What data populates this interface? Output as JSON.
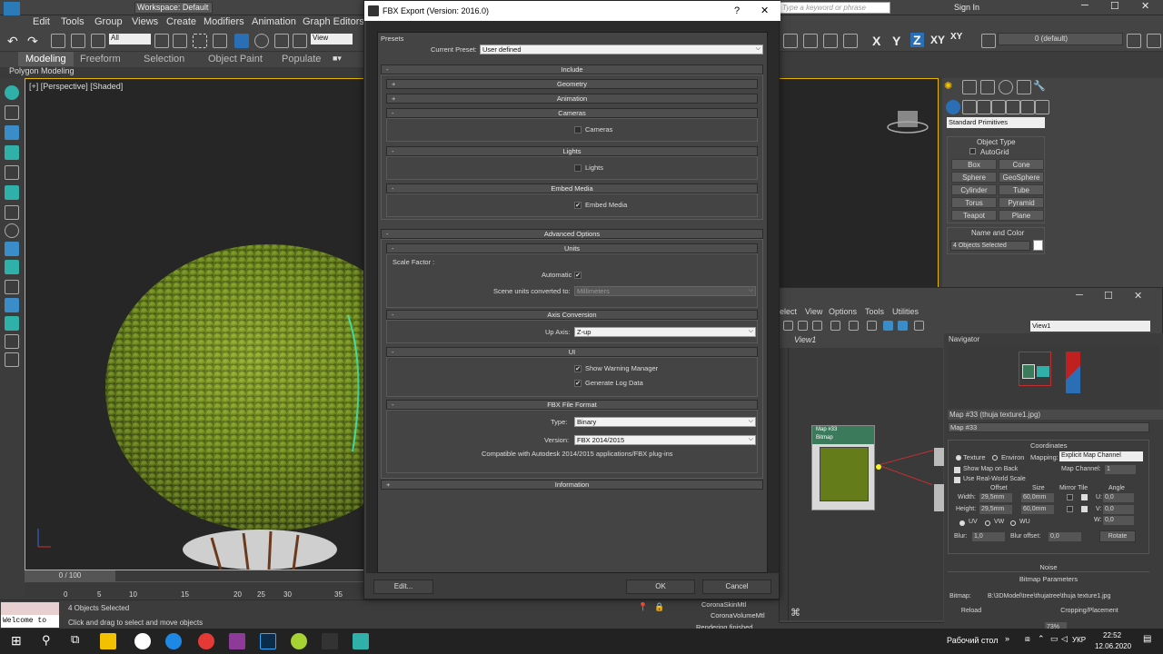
{
  "max": {
    "workspace": "Workspace: Default",
    "search_placeholder": "Type a keyword or phrase",
    "sign_in": "Sign In",
    "menu": [
      "Edit",
      "Tools",
      "Group",
      "Views",
      "Create",
      "Modifiers",
      "Animation",
      "Graph Editors"
    ],
    "toolbar": {
      "filter": "All",
      "refcoord": "View",
      "axes": [
        "X",
        "Y",
        "Z",
        "XY",
        "XY"
      ],
      "selection_set": "0 (default)"
    },
    "ribbon_tabs": [
      "Modeling",
      "Freeform",
      "Selection",
      "Object Paint",
      "Populate"
    ],
    "sub_ribbon": "Polygon Modeling",
    "viewport_label": "[+] [Perspective] [Shaded]",
    "timeline": {
      "frame": "0 / 100",
      "ticks": [
        "0",
        "5",
        "10",
        "15",
        "20",
        "25",
        "30",
        "35"
      ]
    },
    "status": {
      "selected": "4 Objects Selected",
      "hint": "Click and drag to select and move objects",
      "listener": "Welcome to"
    }
  },
  "rightpanel": {
    "category": "Standard Primitives",
    "object_type_header": "Object Type",
    "autogrid": "AutoGrid",
    "primitives": [
      "Box",
      "Cone",
      "Sphere",
      "GeoSphere",
      "Cylinder",
      "Tube",
      "Torus",
      "Pyramid",
      "Teapot",
      "Plane"
    ],
    "name_color_header": "Name and Color",
    "name_value": "4 Objects Selected"
  },
  "slate": {
    "menu": [
      "elect",
      "View",
      "Options",
      "Tools",
      "Utilities"
    ],
    "view_combo": "View1",
    "view_tab": "View1",
    "navigator": "Navigator",
    "node_title": "Map #33",
    "node_sub": "Bitmap",
    "mat_list": [
      "CoronaSkinMtl",
      "CoronaVolumeMtl"
    ],
    "rendering": "Rendering finished",
    "map_header": "Map #33  (thuja texture1.jpg)",
    "map_name": "Map #33",
    "coordinates_header": "Coordinates",
    "texture": "Texture",
    "environ": "Environ",
    "mapping_label": "Mapping:",
    "mapping_value": "Explicit Map Channel",
    "show_map_back": "Show Map on Back",
    "map_channel_label": "Map Channel:",
    "map_channel_value": "1",
    "use_real_world": "Use Real-World Scale",
    "col_offset": "Offset",
    "col_size": "Size",
    "col_mirror": "Mirror Tile",
    "col_angle": "Angle",
    "width_label": "Width:",
    "width_offset": "29,5mm",
    "width_size": "60,0mm",
    "height_label": "Height:",
    "height_offset": "29,5mm",
    "height_size": "60,0mm",
    "u_label": "U:",
    "u_angle": "0,0",
    "v_label": "V:",
    "v_angle": "0,0",
    "w_label": "W:",
    "w_angle": "0,0",
    "uv": "UV",
    "vw": "VW",
    "wu": "WU",
    "blur_label": "Blur:",
    "blur_value": "1,0",
    "blur_offset_label": "Blur offset:",
    "blur_offset_value": "0,0",
    "rotate": "Rotate",
    "noise_header": "Noise",
    "bitmap_params_header": "Bitmap Parameters",
    "bitmap_label": "Bitmap:",
    "bitmap_path": "B:\\3DModel\\tree\\thujatree\\thuja texture1.jpg",
    "reload": "Reload",
    "cropping": "Cropping/Placement",
    "zoom": "73%"
  },
  "dialog": {
    "title": "FBX Export (Version: 2016.0)",
    "help": "?",
    "close": "✕",
    "presets_label": "Presets",
    "current_preset_label": "Current Preset:",
    "current_preset": "User defined",
    "include": "Include",
    "geometry": "Geometry",
    "animation": "Animation",
    "cameras": "Cameras",
    "cameras_cb": "Cameras",
    "lights": "Lights",
    "lights_cb": "Lights",
    "embed_media": "Embed Media",
    "embed_media_cb": "Embed Media",
    "advanced_options": "Advanced Options",
    "units": "Units",
    "scale_factor": "Scale Factor :",
    "automatic": "Automatic",
    "scene_units_label": "Scene units converted to:",
    "scene_units": "Millimeters",
    "axis_conversion": "Axis Conversion",
    "up_axis_label": "Up Axis:",
    "up_axis": "Z-up",
    "ui": "UI",
    "show_warning": "Show Warning Manager",
    "generate_log": "Generate Log Data",
    "fbx_file_format": "FBX File Format",
    "type_label": "Type:",
    "type_value": "Binary",
    "version_label": "Version:",
    "version_value": "FBX 2014/2015",
    "compat": "Compatible with Autodesk 2014/2015 applications/FBX plug-ins",
    "information": "Information",
    "edit_btn": "Edit...",
    "ok_btn": "OK",
    "cancel_btn": "Cancel"
  },
  "taskbar": {
    "desktop": "Рабочий стол",
    "lang": "УКР",
    "time": "22:52",
    "date": "12.06.2020"
  }
}
